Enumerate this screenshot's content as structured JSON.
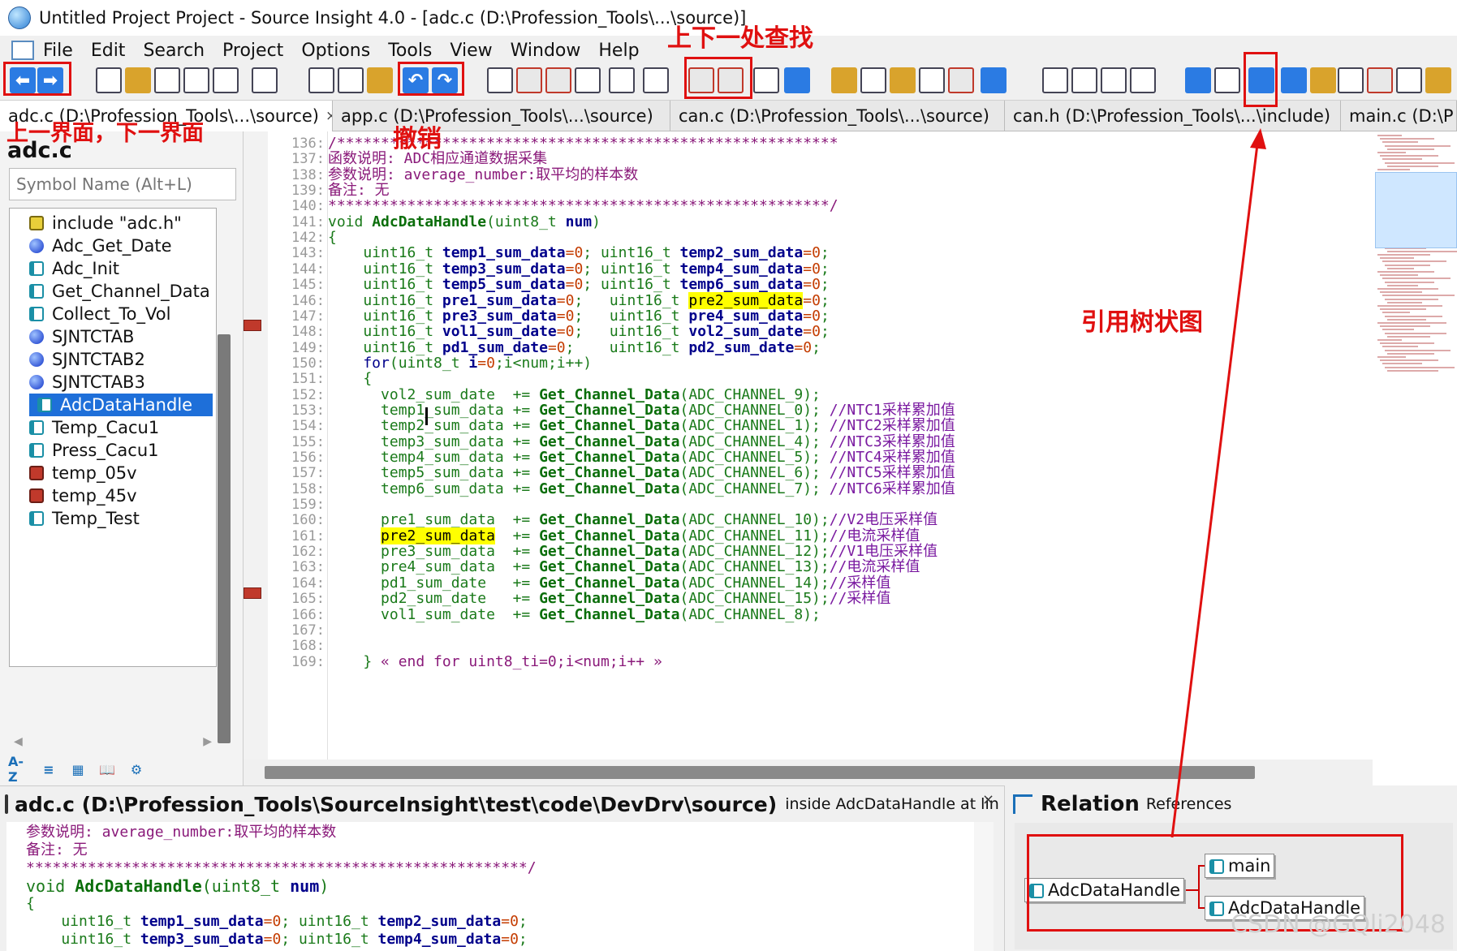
{
  "window": {
    "title": "Untitled Project Project - Source Insight 4.0 - [adc.c (D:\\Profession_Tools\\...\\source)]"
  },
  "menu": {
    "items": [
      "File",
      "Edit",
      "Search",
      "Project",
      "Options",
      "Tools",
      "View",
      "Window",
      "Help"
    ]
  },
  "toolbar": {
    "icons": [
      "back-icon",
      "forward-icon",
      "new-file-icon",
      "open-folder-icon",
      "save-icon",
      "save-all-icon",
      "close-all-icon",
      "print-icon",
      "cut-icon",
      "copy-icon",
      "paste-icon",
      "undo-icon",
      "redo-icon",
      "lookup-icon",
      "jump-up-icon",
      "jump-down-icon",
      "search-files-icon",
      "replace-icon",
      "browse-icon",
      "search-prev-icon",
      "search-next-icon",
      "symbol-list-icon",
      "bookmark-icon",
      "chart-icon",
      "window-icon",
      "book-icon",
      "function-icon",
      "call-icon",
      "highlight-icon",
      "layout-1-icon",
      "layout-2-icon",
      "layout-3-icon",
      "layout-4-icon",
      "settings-icon",
      "relation-icon",
      "relation-tree-icon",
      "symbol-window-icon",
      "project-icon",
      "context-icon",
      "help-icon",
      "save-config-icon",
      "exit-icon"
    ]
  },
  "tabs": [
    {
      "label": "adc.c (D:\\Profession_Tools\\...\\source)",
      "close": "×"
    },
    {
      "label": "app.c (D:\\Profession_Tools\\...\\source)"
    },
    {
      "label": "can.c (D:\\Profession_Tools\\...\\source)"
    },
    {
      "label": "can.h (D:\\Profession_Tools\\...\\include)"
    },
    {
      "label": "main.c (D:\\P"
    }
  ],
  "symbolPanel": {
    "fileTitle": "adc.c",
    "searchPlaceholder": "Symbol Name (Alt+L)",
    "items": [
      {
        "label": "include \"adc.h\"",
        "kind": "inc"
      },
      {
        "label": "Adc_Get_Date",
        "kind": "var"
      },
      {
        "label": "Adc_Init",
        "kind": "fn"
      },
      {
        "label": "Get_Channel_Data",
        "kind": "fn"
      },
      {
        "label": "Collect_To_Vol",
        "kind": "fn"
      },
      {
        "label": "SJNTCTAB",
        "kind": "var"
      },
      {
        "label": "SJNTCTAB2",
        "kind": "var"
      },
      {
        "label": "SJNTCTAB3",
        "kind": "var"
      },
      {
        "label": "AdcDataHandle",
        "kind": "fn",
        "selected": true
      },
      {
        "label": "Temp_Cacu1",
        "kind": "fn"
      },
      {
        "label": "Press_Cacu1",
        "kind": "fn"
      },
      {
        "label": "temp_05v",
        "kind": "def"
      },
      {
        "label": "temp_45v",
        "kind": "def"
      },
      {
        "label": "Temp_Test",
        "kind": "fn"
      }
    ],
    "footer": [
      "A-Z",
      "≡",
      "▦",
      "📖",
      "⚙"
    ]
  },
  "editor": {
    "lines": [
      {
        "n": "136:",
        "segs": [
          [
            "cm",
            "/*********************************************************"
          ]
        ]
      },
      {
        "n": "137:",
        "segs": [
          [
            "cm",
            "函数说明: ADC相应通道数据采集"
          ]
        ]
      },
      {
        "n": "138:",
        "segs": [
          [
            "cm",
            "参数说明: average_number:取平均的样本数"
          ]
        ]
      },
      {
        "n": "139:",
        "segs": [
          [
            "cm",
            "备注: 无"
          ]
        ]
      },
      {
        "n": "140:",
        "segs": [
          [
            "cm",
            "*********************************************************/"
          ]
        ]
      },
      {
        "n": "141:",
        "segs": [
          [
            "ty",
            "void "
          ],
          [
            "fn",
            "AdcDataHandle"
          ],
          [
            "ty",
            "(uint8_t "
          ],
          [
            "va",
            "num"
          ],
          [
            "ty",
            ")"
          ]
        ]
      },
      {
        "n": "142:",
        "segs": [
          [
            "ty",
            "{"
          ]
        ]
      },
      {
        "n": "143:",
        "segs": [
          [
            "ty",
            "    uint16_t "
          ],
          [
            "va",
            "temp1_sum_data"
          ],
          [
            "nu",
            "=0"
          ],
          [
            "ty",
            "; uint16_t "
          ],
          [
            "va",
            "temp2_sum_data"
          ],
          [
            "nu",
            "=0"
          ],
          [
            "ty",
            ";"
          ]
        ]
      },
      {
        "n": "144:",
        "segs": [
          [
            "ty",
            "    uint16_t "
          ],
          [
            "va",
            "temp3_sum_data"
          ],
          [
            "nu",
            "=0"
          ],
          [
            "ty",
            "; uint16_t "
          ],
          [
            "va",
            "temp4_sum_data"
          ],
          [
            "nu",
            "=0"
          ],
          [
            "ty",
            ";"
          ]
        ]
      },
      {
        "n": "145:",
        "segs": [
          [
            "ty",
            "    uint16_t "
          ],
          [
            "va",
            "temp5_sum_data"
          ],
          [
            "nu",
            "=0"
          ],
          [
            "ty",
            "; uint16_t "
          ],
          [
            "va",
            "temp6_sum_data"
          ],
          [
            "nu",
            "=0"
          ],
          [
            "ty",
            ";"
          ]
        ]
      },
      {
        "n": "146:",
        "segs": [
          [
            "ty",
            "    uint16_t "
          ],
          [
            "va",
            "pre1_sum_data"
          ],
          [
            "nu",
            "=0"
          ],
          [
            "ty",
            ";   uint16_t "
          ],
          [
            "hl",
            "pre2_sum_data"
          ],
          [
            "nu",
            "=0"
          ],
          [
            "ty",
            ";"
          ]
        ]
      },
      {
        "n": "147:",
        "segs": [
          [
            "ty",
            "    uint16_t "
          ],
          [
            "va",
            "pre3_sum_data"
          ],
          [
            "nu",
            "=0"
          ],
          [
            "ty",
            ";   uint16_t "
          ],
          [
            "va",
            "pre4_sum_data"
          ],
          [
            "nu",
            "=0"
          ],
          [
            "ty",
            ";"
          ]
        ]
      },
      {
        "n": "148:",
        "segs": [
          [
            "ty",
            "    uint16_t "
          ],
          [
            "va",
            "vol1_sum_date"
          ],
          [
            "nu",
            "=0"
          ],
          [
            "ty",
            ";   uint16_t "
          ],
          [
            "va",
            "vol2_sum_date"
          ],
          [
            "nu",
            "=0"
          ],
          [
            "ty",
            ";"
          ]
        ]
      },
      {
        "n": "149:",
        "segs": [
          [
            "ty",
            "    uint16_t "
          ],
          [
            "va",
            "pd1_sum_date"
          ],
          [
            "nu",
            "=0"
          ],
          [
            "ty",
            ";    uint16_t "
          ],
          [
            "va",
            "pd2_sum_date"
          ],
          [
            "nu",
            "=0"
          ],
          [
            "ty",
            ";"
          ]
        ]
      },
      {
        "n": "150:",
        "segs": [
          [
            "kw",
            "    for"
          ],
          [
            "ty",
            "(uint8_t "
          ],
          [
            "va",
            "i"
          ],
          [
            "nu",
            "=0"
          ],
          [
            "ty",
            ";i<num;i++)"
          ]
        ]
      },
      {
        "n": "151:",
        "segs": [
          [
            "ty",
            "    {"
          ]
        ]
      },
      {
        "n": "152:",
        "segs": [
          [
            "ty",
            "      vol2_sum_date  += "
          ],
          [
            "fn",
            "Get_Channel_Data"
          ],
          [
            "ty",
            "(ADC_CHANNEL_9);"
          ]
        ]
      },
      {
        "n": "153:",
        "segs": [
          [
            "ty",
            "      temp1_sum_data += "
          ],
          [
            "fn",
            "Get_Channel_Data"
          ],
          [
            "ty",
            "(ADC_CHANNEL_0); "
          ],
          [
            "mc",
            "//NTC1采样累加值"
          ]
        ]
      },
      {
        "n": "154:",
        "segs": [
          [
            "ty",
            "      temp2_sum_data += "
          ],
          [
            "fn",
            "Get_Channel_Data"
          ],
          [
            "ty",
            "(ADC_CHANNEL_1); "
          ],
          [
            "mc",
            "//NTC2采样累加值"
          ]
        ]
      },
      {
        "n": "155:",
        "segs": [
          [
            "ty",
            "      temp3_sum_data += "
          ],
          [
            "fn",
            "Get_Channel_Data"
          ],
          [
            "ty",
            "(ADC_CHANNEL_4); "
          ],
          [
            "mc",
            "//NTC3采样累加值"
          ]
        ]
      },
      {
        "n": "156:",
        "segs": [
          [
            "ty",
            "      temp4_sum_data += "
          ],
          [
            "fn",
            "Get_Channel_Data"
          ],
          [
            "ty",
            "(ADC_CHANNEL_5); "
          ],
          [
            "mc",
            "//NTC4采样累加值"
          ]
        ]
      },
      {
        "n": "157:",
        "segs": [
          [
            "ty",
            "      temp5_sum_data += "
          ],
          [
            "fn",
            "Get_Channel_Data"
          ],
          [
            "ty",
            "(ADC_CHANNEL_6); "
          ],
          [
            "mc",
            "//NTC5采样累加值"
          ]
        ]
      },
      {
        "n": "158:",
        "segs": [
          [
            "ty",
            "      temp6_sum_data += "
          ],
          [
            "fn",
            "Get_Channel_Data"
          ],
          [
            "ty",
            "(ADC_CHANNEL_7); "
          ],
          [
            "mc",
            "//NTC6采样累加值"
          ]
        ]
      },
      {
        "n": "159:",
        "segs": []
      },
      {
        "n": "160:",
        "segs": [
          [
            "ty",
            "      pre1_sum_data  += "
          ],
          [
            "fn",
            "Get_Channel_Data"
          ],
          [
            "ty",
            "(ADC_CHANNEL_10);"
          ],
          [
            "mc",
            "//V2电压采样值"
          ]
        ]
      },
      {
        "n": "161:",
        "segs": [
          [
            "ty",
            "      "
          ],
          [
            "hl",
            "pre2_sum_data"
          ],
          [
            "ty",
            "  += "
          ],
          [
            "fn",
            "Get_Channel_Data"
          ],
          [
            "ty",
            "(ADC_CHANNEL_11);"
          ],
          [
            "mc",
            "//电流采样值"
          ]
        ]
      },
      {
        "n": "162:",
        "segs": [
          [
            "ty",
            "      pre3_sum_data  += "
          ],
          [
            "fn",
            "Get_Channel_Data"
          ],
          [
            "ty",
            "(ADC_CHANNEL_12);"
          ],
          [
            "mc",
            "//V1电压采样值"
          ]
        ]
      },
      {
        "n": "163:",
        "segs": [
          [
            "ty",
            "      pre4_sum_data  += "
          ],
          [
            "fn",
            "Get_Channel_Data"
          ],
          [
            "ty",
            "(ADC_CHANNEL_13);"
          ],
          [
            "mc",
            "//电流采样值"
          ]
        ]
      },
      {
        "n": "164:",
        "segs": [
          [
            "ty",
            "      pd1_sum_date   += "
          ],
          [
            "fn",
            "Get_Channel_Data"
          ],
          [
            "ty",
            "(ADC_CHANNEL_14);"
          ],
          [
            "mc",
            "//采样值"
          ]
        ]
      },
      {
        "n": "165:",
        "segs": [
          [
            "ty",
            "      pd2_sum_date   += "
          ],
          [
            "fn",
            "Get_Channel_Data"
          ],
          [
            "ty",
            "(ADC_CHANNEL_15);"
          ],
          [
            "mc",
            "//采样值"
          ]
        ]
      },
      {
        "n": "166:",
        "segs": [
          [
            "ty",
            "      vol1_sum_date  += "
          ],
          [
            "fn",
            "Get_Channel_Data"
          ],
          [
            "ty",
            "(ADC_CHANNEL_8);"
          ]
        ]
      },
      {
        "n": "167:",
        "segs": []
      },
      {
        "n": "168:",
        "segs": []
      },
      {
        "n": "169:",
        "segs": [
          [
            "ty",
            "    } "
          ],
          [
            "cm",
            "« end for uint8_ti=0;i<num;i++ »"
          ]
        ]
      }
    ]
  },
  "contextPanel": {
    "title": "adc.c (D:\\Profession_Tools\\SourceInsight\\test\\code\\DevDrv\\source)",
    "subtitle": "inside AdcDataHandle at line",
    "close": "×",
    "lines": [
      {
        "segs": [
          [
            "cm",
            "参数说明: average_number:取平均的样本数"
          ]
        ]
      },
      {
        "segs": [
          [
            "cm",
            "备注: 无"
          ]
        ]
      },
      {
        "segs": [
          [
            "cm",
            "*********************************************************/"
          ]
        ]
      },
      {
        "segs": [
          [
            "ty",
            "void "
          ],
          [
            "fn",
            "AdcDataHandle"
          ],
          [
            "ty",
            "(uint8_t "
          ],
          [
            "va",
            "num"
          ],
          [
            "ty",
            ")"
          ]
        ]
      },
      {
        "segs": [
          [
            "ty",
            "{"
          ]
        ]
      },
      {
        "segs": [
          [
            "ty",
            "    uint16_t "
          ],
          [
            "va",
            "temp1_sum_data"
          ],
          [
            "nu",
            "=0"
          ],
          [
            "ty",
            "; uint16_t "
          ],
          [
            "va",
            "temp2_sum_data"
          ],
          [
            "nu",
            "=0"
          ],
          [
            "ty",
            ";"
          ]
        ]
      },
      {
        "segs": [
          [
            "ty",
            "    uint16_t "
          ],
          [
            "va",
            "temp3_sum_data"
          ],
          [
            "nu",
            "=0"
          ],
          [
            "ty",
            "; uint16_t "
          ],
          [
            "va",
            "temp4_sum_data"
          ],
          [
            "nu",
            "=0"
          ],
          [
            "ty",
            ";"
          ]
        ]
      }
    ]
  },
  "relationPanel": {
    "title": "Relation",
    "subtitle": "References",
    "root": "AdcDataHandle",
    "children": [
      "main",
      "AdcDataHandle"
    ]
  },
  "annotations": {
    "findNav": "上下一处查找",
    "prevNext": "上一界面，下一界面",
    "undo": "撤销",
    "tree": "引用树状图"
  },
  "watermark": "CSDN @GQli2048"
}
